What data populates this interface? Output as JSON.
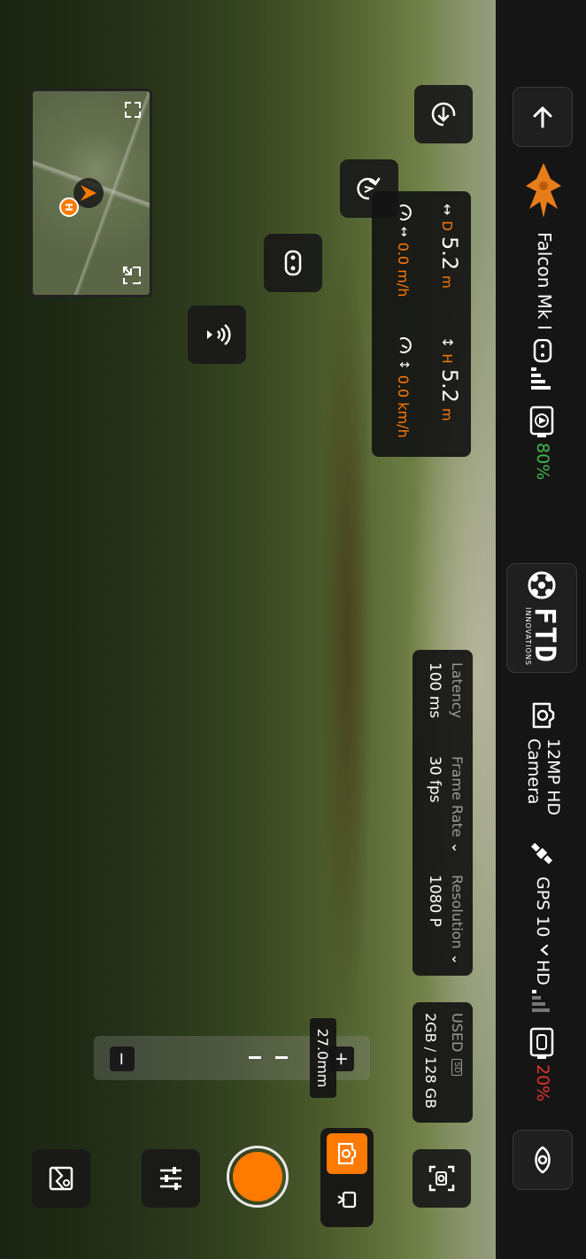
{
  "top_bar": {
    "drone_name": "Falcon Mk I",
    "drone_battery": "80%",
    "brand_name": "FTD",
    "brand_sub": "INNOVATIONS",
    "camera_label_1": "12MP HD",
    "camera_label_2": "Camera",
    "gps_label": "GPS 10",
    "hd_label": "HD",
    "remote_battery": "20%"
  },
  "telemetry": {
    "distance_prefix": "D",
    "distance_value": "5.2",
    "distance_unit": "m",
    "height_prefix": "H",
    "height_value": "5.2",
    "height_unit": "m",
    "horizontal_speed": "0.0 m/h",
    "vertical_speed": "0.0 km/h"
  },
  "stream_info": {
    "latency_label": "Latency",
    "latency_value": "100 ms",
    "framerate_label": "Frame Rate",
    "framerate_value": "30 fps",
    "resolution_label": "Resolution",
    "resolution_value": "1080 P"
  },
  "storage": {
    "label": "USED",
    "card": "SD",
    "value": "2GB / 128 GB"
  },
  "zoom": {
    "value": "27.0mm",
    "plus": "+",
    "minus": "−"
  },
  "minimap": {
    "home_marker": "H"
  },
  "colors": {
    "accent": "#ff7a00",
    "battery_ok": "#42b749",
    "battery_low": "#e3342b",
    "panel": "#141414"
  }
}
